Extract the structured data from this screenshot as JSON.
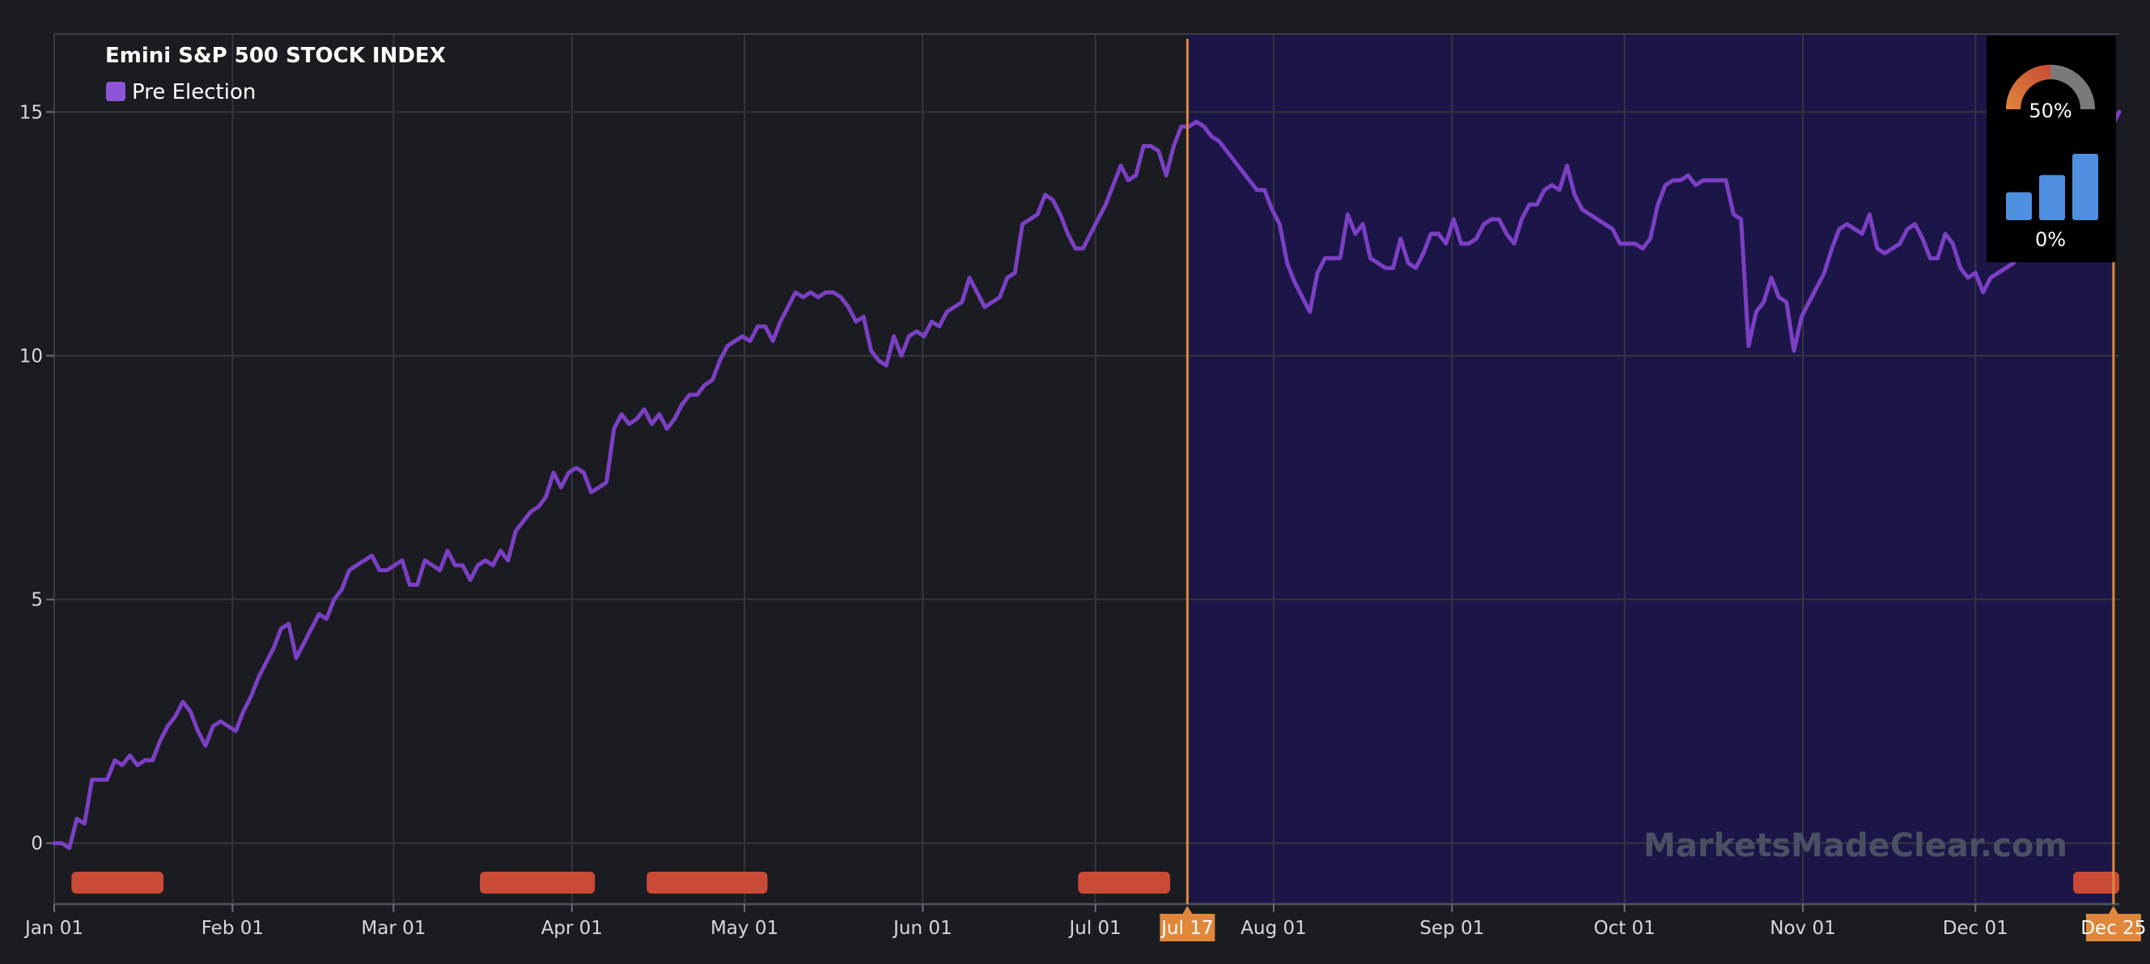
{
  "chart_data": {
    "type": "line",
    "title": "Emini S&P 500 STOCK INDEX",
    "series": [
      {
        "name": "Pre Election",
        "color": "#7b3fc4",
        "legend_color": "#8f55d8",
        "points": [
          [
            "Jan 01",
            0.0
          ],
          [
            "Jan 02",
            0.0
          ],
          [
            "Jan 04",
            -0.1
          ],
          [
            "Jan 06",
            0.5
          ],
          [
            "Jan 07",
            0.4
          ],
          [
            "Jan 09",
            1.3
          ],
          [
            "Jan 11",
            1.3
          ],
          [
            "Jan 14",
            1.3
          ],
          [
            "Jan 16",
            1.7
          ],
          [
            "Jan 17",
            1.6
          ],
          [
            "Jan 19",
            1.8
          ],
          [
            "Jan 21",
            1.6
          ],
          [
            "Jan 23",
            1.7
          ],
          [
            "Jan 26",
            1.7
          ],
          [
            "Jan 28",
            2.1
          ],
          [
            "Jan 30",
            2.4
          ],
          [
            "Feb 01",
            2.6
          ],
          [
            "Feb 03",
            2.9
          ],
          [
            "Feb 05",
            2.7
          ],
          [
            "Feb 09",
            2.3
          ],
          [
            "Feb 12",
            2.0
          ],
          [
            "Feb 16",
            2.4
          ],
          [
            "Feb 19",
            2.5
          ],
          [
            "Feb 22",
            2.4
          ],
          [
            "Feb 25",
            2.3
          ],
          [
            "Feb 27",
            2.7
          ],
          [
            "Feb 28",
            3.0
          ],
          [
            "Mar 01",
            3.4
          ],
          [
            "Mar 04",
            3.7
          ],
          [
            "Mar 08",
            4.0
          ],
          [
            "Mar 10",
            4.4
          ],
          [
            "Mar 12",
            4.5
          ],
          [
            "Mar 14",
            3.8
          ],
          [
            "Mar 16",
            4.1
          ],
          [
            "Mar 19",
            4.4
          ],
          [
            "Mar 22",
            4.7
          ],
          [
            "Mar 24",
            4.6
          ],
          [
            "Mar 26",
            5.0
          ],
          [
            "Mar 28",
            5.2
          ],
          [
            "Mar 30",
            5.6
          ],
          [
            "Apr 01",
            5.7
          ],
          [
            "Apr 03",
            5.8
          ],
          [
            "Apr 05",
            5.9
          ],
          [
            "Apr 08",
            5.6
          ],
          [
            "Apr 10",
            5.6
          ],
          [
            "Apr 13",
            5.7
          ],
          [
            "Apr 16",
            5.8
          ],
          [
            "Apr 18",
            5.3
          ],
          [
            "Apr 20",
            5.3
          ],
          [
            "Apr 22",
            5.8
          ],
          [
            "Apr 25",
            5.7
          ],
          [
            "Apr 27",
            5.6
          ],
          [
            "Apr 29",
            6.0
          ],
          [
            "May 01",
            5.7
          ],
          [
            "May 03",
            5.7
          ],
          [
            "May 05",
            5.4
          ],
          [
            "May 08",
            5.7
          ],
          [
            "May 10",
            5.8
          ],
          [
            "May 12",
            5.7
          ],
          [
            "May 14",
            6.0
          ],
          [
            "May 16",
            5.8
          ],
          [
            "May 17",
            6.4
          ],
          [
            "May 19",
            6.6
          ],
          [
            "May 22",
            6.8
          ],
          [
            "May 24",
            6.9
          ],
          [
            "May 26",
            7.1
          ],
          [
            "May 28",
            7.6
          ],
          [
            "May 30",
            7.3
          ],
          [
            "Jun 03",
            7.6
          ],
          [
            "Jun 05",
            7.7
          ],
          [
            "Jun 08",
            7.6
          ],
          [
            "Jun 10",
            7.2
          ],
          [
            "Jun 12",
            7.3
          ],
          [
            "Jun 15",
            7.4
          ],
          [
            "Jun 18",
            8.5
          ],
          [
            "Jun 20",
            8.8
          ],
          [
            "Jun 22",
            8.6
          ],
          [
            "Jun 24",
            8.7
          ],
          [
            "Jun 26",
            8.9
          ],
          [
            "Jun 28",
            8.6
          ],
          [
            "Jun 30",
            8.8
          ],
          [
            "Jul 01",
            8.5
          ],
          [
            "Jul 03",
            8.7
          ],
          [
            "Jul 06",
            9.0
          ],
          [
            "Jul 08",
            9.2
          ],
          [
            "Jul 10",
            9.2
          ],
          [
            "Jul 12",
            9.4
          ],
          [
            "Jul 14",
            9.5
          ],
          [
            "Jul 16",
            9.9
          ],
          [
            "Jul 19",
            10.2
          ],
          [
            "Jul 22",
            10.3
          ],
          [
            "Jul 24",
            10.4
          ],
          [
            "Jul 26",
            10.3
          ],
          [
            "Jul 28",
            10.6
          ],
          [
            "Jul 30",
            10.6
          ],
          [
            "Aug 02",
            10.3
          ],
          [
            "Aug 04",
            10.7
          ],
          [
            "Aug 06",
            11.0
          ],
          [
            "Aug 08",
            11.3
          ],
          [
            "Aug 10",
            11.2
          ],
          [
            "Aug 12",
            11.3
          ],
          [
            "Aug 14",
            11.2
          ],
          [
            "Aug 17",
            11.3
          ],
          [
            "Aug 20",
            11.3
          ],
          [
            "Aug 22",
            11.2
          ],
          [
            "Aug 24",
            11.0
          ],
          [
            "Aug 26",
            10.7
          ],
          [
            "Aug 28",
            10.8
          ],
          [
            "Aug 29",
            10.1
          ],
          [
            "Sep 01",
            9.9
          ],
          [
            "Sep 03",
            9.8
          ],
          [
            "Sep 05",
            10.4
          ],
          [
            "Sep 07",
            10.0
          ],
          [
            "Sep 09",
            10.4
          ],
          [
            "Sep 11",
            10.5
          ],
          [
            "Sep 14",
            10.4
          ],
          [
            "Sep 16",
            10.7
          ],
          [
            "Sep 18",
            10.6
          ],
          [
            "Sep 20",
            10.9
          ],
          [
            "Sep 23",
            11.0
          ],
          [
            "Sep 25",
            11.1
          ],
          [
            "Sep 27",
            11.6
          ],
          [
            "Sep 29",
            11.3
          ],
          [
            "Oct 01",
            11.0
          ],
          [
            "Oct 03",
            11.1
          ],
          [
            "Oct 06",
            11.2
          ],
          [
            "Oct 08",
            11.6
          ],
          [
            "Oct 10",
            11.7
          ],
          [
            "Oct 12",
            12.7
          ],
          [
            "Oct 15",
            12.8
          ],
          [
            "Oct 18",
            12.9
          ],
          [
            "Oct 20",
            13.3
          ],
          [
            "Oct 23",
            13.2
          ],
          [
            "Oct 25",
            12.9
          ],
          [
            "Oct 27",
            12.5
          ],
          [
            "Oct 29",
            12.2
          ],
          [
            "Oct 31",
            12.2
          ],
          [
            "Nov 02",
            12.5
          ],
          [
            "Nov 05",
            12.8
          ],
          [
            "Nov 07",
            13.1
          ],
          [
            "Nov 09",
            13.5
          ],
          [
            "Nov 11",
            13.9
          ],
          [
            "Nov 13",
            13.6
          ],
          [
            "Nov 15",
            13.7
          ],
          [
            "Nov 17",
            14.3
          ],
          [
            "Nov 21",
            14.3
          ],
          [
            "Nov 23",
            14.2
          ],
          [
            "Nov 25",
            13.7
          ],
          [
            "Nov 27",
            14.3
          ],
          [
            "Nov 29",
            14.7
          ],
          [
            "Dec 01",
            14.7
          ],
          [
            "Dec 03",
            14.8
          ],
          [
            "Dec 05",
            14.7
          ],
          [
            "Dec 07",
            14.5
          ],
          [
            "Dec 09",
            14.4
          ],
          [
            "Dec 12",
            14.2
          ],
          [
            "Dec 14",
            14.0
          ],
          [
            "Dec 16",
            13.8
          ],
          [
            "Dec 18",
            13.6
          ],
          [
            "Dec 20",
            13.4
          ],
          [
            "Dec 21",
            13.4
          ],
          [
            "Dec 22",
            13.0
          ],
          [
            "Dec 24",
            12.7
          ],
          [
            "Dec 26",
            11.9
          ],
          [
            "Dec 28",
            11.5
          ],
          [
            "Dec 30",
            11.2
          ],
          [
            "Jan 01",
            10.9
          ],
          [
            "Jan 03",
            11.7
          ],
          [
            "Jan 05",
            12.0
          ],
          [
            "Jan 07",
            12.0
          ],
          [
            "Jan 10",
            12.0
          ],
          [
            "Jan 12",
            12.9
          ],
          [
            "Jan 14",
            12.5
          ],
          [
            "Jan 15",
            12.7
          ],
          [
            "Jan 17",
            12.0
          ],
          [
            "Jan 20",
            11.9
          ],
          [
            "Jan 22",
            11.8
          ],
          [
            "Jan 24",
            11.8
          ],
          [
            "Jan 25",
            12.4
          ],
          [
            "Jan 27",
            11.9
          ],
          [
            "Jan 29",
            11.8
          ],
          [
            "Jan 31",
            12.1
          ],
          [
            "Feb 03",
            12.5
          ],
          [
            "Feb 05",
            12.5
          ],
          [
            "Feb 07",
            12.3
          ],
          [
            "Feb 09",
            12.8
          ],
          [
            "Feb 11",
            12.3
          ],
          [
            "Feb 14",
            12.3
          ],
          [
            "Feb 16",
            12.4
          ],
          [
            "Feb 19",
            12.7
          ],
          [
            "Feb 21",
            12.8
          ],
          [
            "Feb 24",
            12.8
          ],
          [
            "Feb 26",
            12.5
          ],
          [
            "Feb 29",
            12.3
          ],
          [
            "Mar 02",
            12.8
          ],
          [
            "Mar 04",
            13.1
          ],
          [
            "Mar 06",
            13.1
          ],
          [
            "Mar 09",
            13.4
          ],
          [
            "Mar 11",
            13.5
          ],
          [
            "Mar 12",
            13.4
          ],
          [
            "Mar 14",
            13.9
          ],
          [
            "Mar 16",
            13.3
          ],
          [
            "Mar 18",
            13.0
          ],
          [
            "Mar 21",
            12.9
          ],
          [
            "Mar 23",
            12.8
          ],
          [
            "Mar 25",
            12.7
          ],
          [
            "Mar 27",
            12.6
          ],
          [
            "Mar 29",
            12.3
          ],
          [
            "Mar 31",
            12.3
          ],
          [
            "Apr 02",
            12.3
          ],
          [
            "Apr 05",
            12.2
          ],
          [
            "Apr 07",
            12.4
          ],
          [
            "Apr 09",
            13.1
          ],
          [
            "Apr 11",
            13.5
          ],
          [
            "Apr 14",
            13.6
          ],
          [
            "Apr 16",
            13.6
          ],
          [
            "Apr 18",
            13.7
          ],
          [
            "Apr 20",
            13.5
          ],
          [
            "Apr 23",
            13.6
          ],
          [
            "Apr 25",
            13.6
          ],
          [
            "Apr 27",
            13.6
          ],
          [
            "Apr 29",
            13.6
          ],
          [
            "May 02",
            12.9
          ],
          [
            "May 03",
            12.8
          ],
          [
            "May 05",
            10.2
          ],
          [
            "May 07",
            10.9
          ],
          [
            "May 09",
            11.1
          ],
          [
            "May 12",
            11.6
          ],
          [
            "May 14",
            11.2
          ],
          [
            "May 16",
            11.1
          ],
          [
            "May 17",
            10.1
          ],
          [
            "May 19",
            10.8
          ],
          [
            "May 21",
            11.1
          ],
          [
            "May 23",
            11.4
          ],
          [
            "May 25",
            11.7
          ],
          [
            "May 27",
            12.2
          ],
          [
            "May 29",
            12.6
          ],
          [
            "Jun 01",
            12.7
          ],
          [
            "Jun 04",
            12.6
          ],
          [
            "Jun 07",
            12.5
          ],
          [
            "Jun 09",
            12.9
          ],
          [
            "Jun 11",
            12.2
          ],
          [
            "Jun 13",
            12.1
          ],
          [
            "Jun 15",
            12.2
          ],
          [
            "Jun 18",
            12.3
          ],
          [
            "Jun 20",
            12.6
          ],
          [
            "Jun 22",
            12.7
          ],
          [
            "Jun 24",
            12.4
          ],
          [
            "Jun 26",
            12.0
          ],
          [
            "Jun 28",
            12.0
          ],
          [
            "Jul 01",
            12.5
          ],
          [
            "Jul 03",
            12.3
          ],
          [
            "Jul 05",
            11.8
          ],
          [
            "Jul 07",
            11.6
          ],
          [
            "Jul 09",
            11.7
          ],
          [
            "Jul 11",
            11.3
          ],
          [
            "Jul 13",
            11.6
          ],
          [
            "Jul 16",
            11.7
          ],
          [
            "Jul 18",
            11.8
          ],
          [
            "Jul 20",
            11.9
          ],
          [
            "Jul 22",
            12.1
          ],
          [
            "Jul 24",
            12.4
          ],
          [
            "Jul 27",
            12.5
          ],
          [
            "Jul 29",
            12.3
          ],
          [
            "Jul 31",
            12.6
          ],
          [
            "Aug 02",
            12.7
          ],
          [
            "Aug 05",
            12.9
          ],
          [
            "Aug 08",
            13.2
          ],
          [
            "Aug 11",
            13.4
          ],
          [
            "Aug 15",
            13.6
          ],
          [
            "Aug 19",
            14.1
          ],
          [
            "Aug 22",
            14.4
          ],
          [
            "Aug 26",
            14.7
          ],
          [
            "Aug 30",
            15.0
          ]
        ]
      }
    ],
    "x_axis": {
      "start_index": 0,
      "end_index": 359,
      "ticks": [
        {
          "label": "Jan 01",
          "i": 0
        },
        {
          "label": "Feb 01",
          "i": 31
        },
        {
          "label": "Mar 01",
          "i": 59
        },
        {
          "label": "Apr 01",
          "i": 90
        },
        {
          "label": "May 01",
          "i": 120
        },
        {
          "label": "Jun 01",
          "i": 151
        },
        {
          "label": "Jul 01",
          "i": 181
        },
        {
          "label": "Aug 01",
          "i": 212
        },
        {
          "label": "Sep 01",
          "i": 243
        },
        {
          "label": "Oct 01",
          "i": 273
        },
        {
          "label": "Nov 01",
          "i": 304
        },
        {
          "label": "Dec 01",
          "i": 334
        }
      ]
    },
    "y_axis": {
      "ylim": [
        -1.25,
        16.6
      ],
      "ticks": [
        0,
        5,
        10,
        15
      ]
    },
    "grid": true,
    "highlight_region": {
      "from_index": 197,
      "to_index": 358,
      "color": "#1c1648"
    },
    "markers": [
      {
        "label": "Jul 17",
        "i": 197,
        "color": "#e0873a"
      },
      {
        "label": "Dec 25",
        "i": 358,
        "color": "#e0873a"
      }
    ],
    "bottom_bars": {
      "color": "#c94a36",
      "ranges": [
        [
          3,
          19
        ],
        [
          74,
          94
        ],
        [
          103,
          124
        ],
        [
          178,
          194
        ],
        [
          351,
          363
        ]
      ]
    },
    "watermark": "MarketsMadeClear.com",
    "widget": {
      "gauge_label": "50%",
      "gauge_value": 0.5,
      "bars_label": "0%",
      "bar_levels": [
        0.42,
        0.68,
        1.0
      ]
    }
  },
  "colors": {
    "background": "#1b1c21",
    "grid": "#34363d",
    "line": "#7b3fc4",
    "highlight": "#1c1648",
    "marker": "#e0873a",
    "bottom_bar": "#c94a36",
    "widget_bars": "#4f8fe0"
  }
}
